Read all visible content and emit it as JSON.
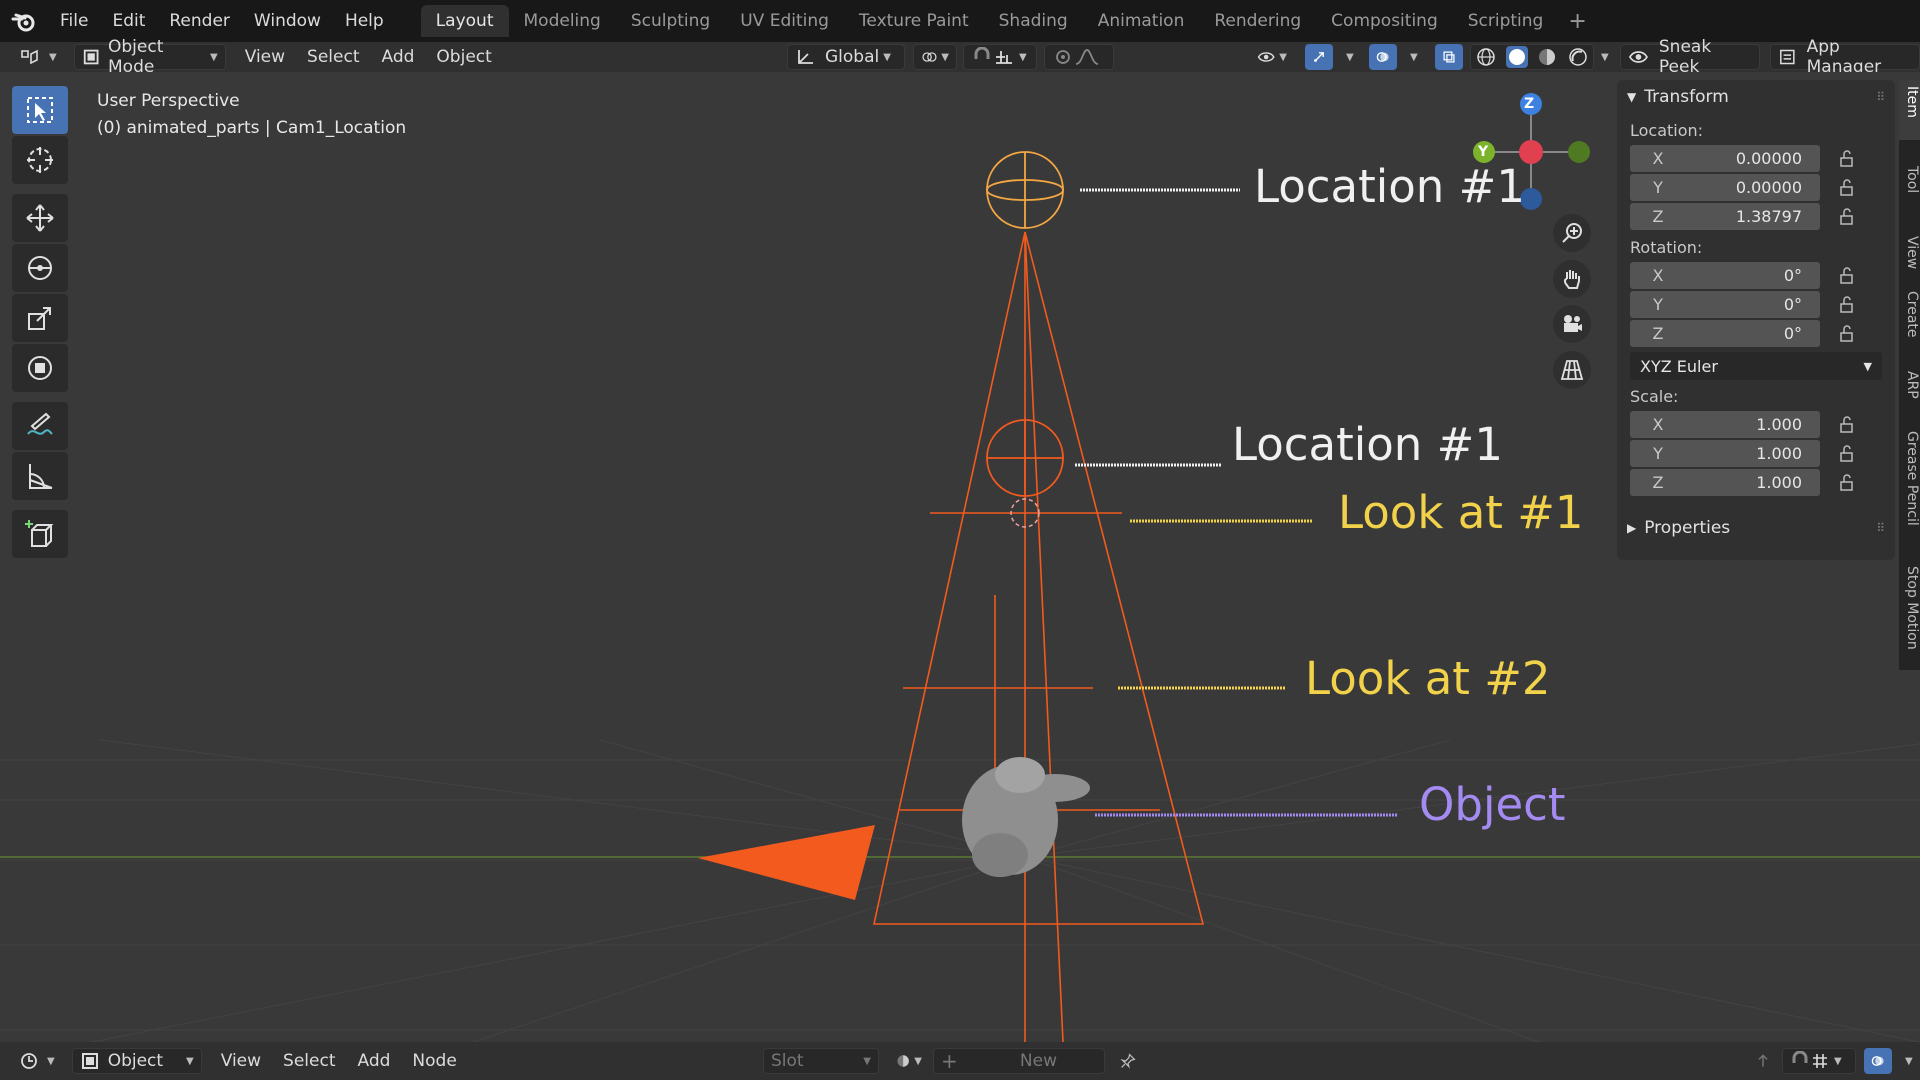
{
  "topbar": {
    "menus": [
      "File",
      "Edit",
      "Render",
      "Window",
      "Help"
    ],
    "workspaces": [
      "Layout",
      "Modeling",
      "Sculpting",
      "UV Editing",
      "Texture Paint",
      "Shading",
      "Animation",
      "Rendering",
      "Compositing",
      "Scripting"
    ],
    "active_workspace": "Layout",
    "add_symbol": "+"
  },
  "header": {
    "mode": "Object Mode",
    "menus": [
      "View",
      "Select",
      "Add",
      "Object"
    ],
    "orientation": "Global",
    "sneak_peek": "Sneak Peek",
    "app_manager": "App Manager"
  },
  "viewport": {
    "perspective": "User Perspective",
    "object_info": "(0) animated_parts | Cam1_Location",
    "gizmo": {
      "z": "Z",
      "y": "Y"
    },
    "annotations": {
      "location1_top": "Location #1",
      "location1_mid": "Location #1",
      "look_at_1": "Look at #1",
      "look_at_2": "Look at #2",
      "object": "Object"
    },
    "colors": {
      "white": "#f0f0f0",
      "yellow": "#f2d24a",
      "purple": "#a48bf2",
      "camera": "#f25a1e",
      "selected": "#f5a742"
    }
  },
  "npanel": {
    "transform_title": "Transform",
    "location_label": "Location:",
    "location": [
      {
        "axis": "X",
        "value": "0.00000"
      },
      {
        "axis": "Y",
        "value": "0.00000"
      },
      {
        "axis": "Z",
        "value": "1.38797"
      }
    ],
    "rotation_label": "Rotation:",
    "rotation": [
      {
        "axis": "X",
        "value": "0°"
      },
      {
        "axis": "Y",
        "value": "0°"
      },
      {
        "axis": "Z",
        "value": "0°"
      }
    ],
    "rotation_mode": "XYZ Euler",
    "scale_label": "Scale:",
    "scale": [
      {
        "axis": "X",
        "value": "1.000"
      },
      {
        "axis": "Y",
        "value": "1.000"
      },
      {
        "axis": "Z",
        "value": "1.000"
      }
    ],
    "properties_title": "Properties"
  },
  "side_tabs": [
    "Item",
    "Tool",
    "View",
    "Create",
    "ARP",
    "Grease Pencil",
    "Stop Motion"
  ],
  "bottombar": {
    "editor_mode": "Object",
    "menus": [
      "View",
      "Select",
      "Add",
      "Node"
    ],
    "slot": "Slot",
    "new_label": "New"
  }
}
